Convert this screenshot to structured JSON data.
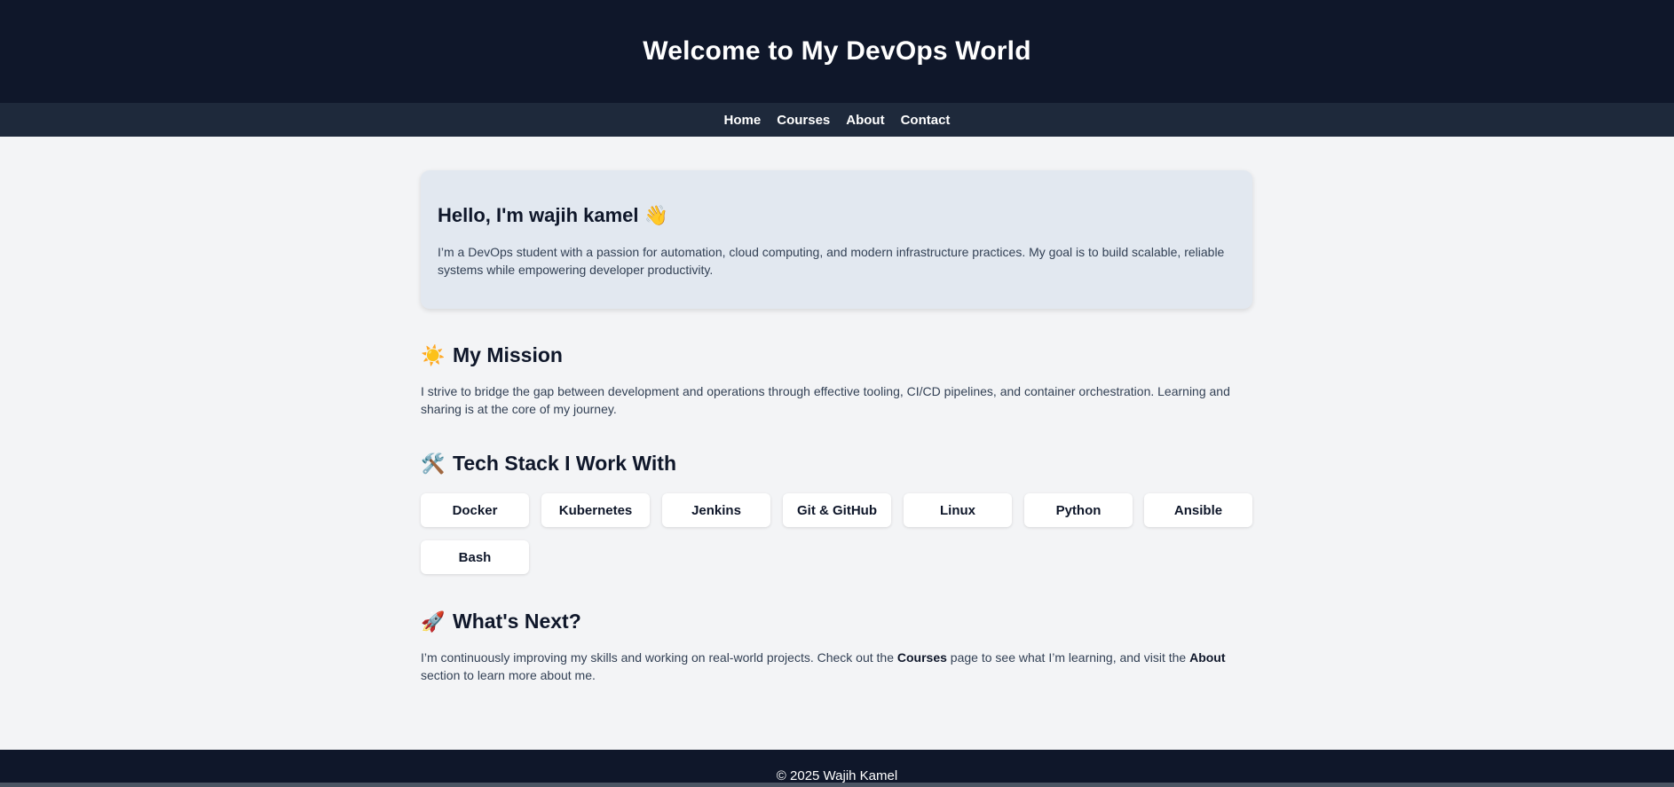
{
  "header": {
    "title": "Welcome to My DevOps World"
  },
  "nav": {
    "items": [
      {
        "label": "Home"
      },
      {
        "label": "Courses"
      },
      {
        "label": "About"
      },
      {
        "label": "Contact"
      }
    ]
  },
  "intro": {
    "title": "Hello, I'm wajih kamel 👋",
    "text": "I’m a DevOps student with a passion for automation, cloud computing, and modern infrastructure practices. My goal is to build scalable, reliable systems while empowering developer productivity."
  },
  "mission": {
    "icon": "☀️",
    "title": "My Mission",
    "text": "I strive to bridge the gap between development and operations through effective tooling, CI/CD pipelines, and container orchestration. Learning and sharing is at the core of my journey."
  },
  "tech_stack": {
    "icon": "🛠️",
    "title": "Tech Stack I Work With",
    "items": [
      "Docker",
      "Kubernetes",
      "Jenkins",
      "Git & GitHub",
      "Linux",
      "Python",
      "Ansible",
      "Bash"
    ]
  },
  "whats_next": {
    "icon": "🚀",
    "title": "What's Next?",
    "text_before_courses": "I’m continuously improving my skills and working on real-world projects. Check out the ",
    "courses_word": "Courses",
    "text_between": " page to see what I’m learning, and visit the ",
    "about_word": "About",
    "text_after_about": " section to learn more about me."
  },
  "footer": {
    "text": "© 2025 Wajih Kamel"
  },
  "colors": {
    "header_bg": "#0f172a",
    "nav_bg": "#1e293b",
    "page_bg": "#f3f4f6",
    "card_bg": "#e2e8f0",
    "chip_bg": "#ffffff"
  }
}
